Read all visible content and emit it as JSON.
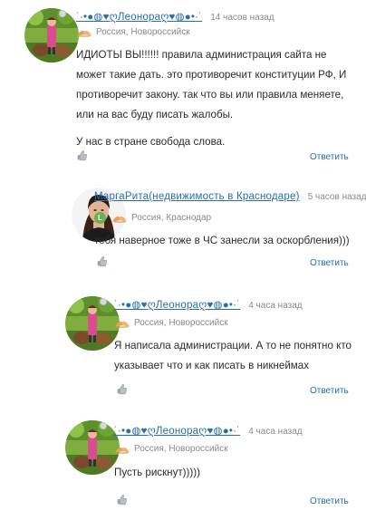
{
  "comments": [
    {
      "author": "˙·•●◍♥ღ​Леонораღ♥◍●•·˙",
      "time": "14 часов назад",
      "location": "Россия, Новороссийск",
      "paragraphs": [
        "ИДИОТЫ ВЫ!!!!!! правила администрация сайта не может такие дать. это противоречит конституции РФ, И противоречит закону. так что вы или правила меняете, или на вас буду писать жалобы.",
        "У нас в стране свобода слова."
      ],
      "reply_label": "Ответить"
    },
    {
      "author": "МаргаРита(недвижимость в Краснодаре)",
      "time": "5 часов назад",
      "location": "Россия, Краснодар",
      "badge": "L",
      "paragraphs": [
        "тебя наверное тоже в ЧС занесли за оскорбления)))"
      ],
      "reply_label": "Ответить"
    },
    {
      "author": "˙·•●◍♥ღ​Леонораღ♥◍●•·˙",
      "time": "4 часа назад",
      "location": "Россия, Новороссийск",
      "paragraphs": [
        "Я написала администрации. А то не понятно кто указывает что и как писать в никнеймах"
      ],
      "reply_label": "Ответить"
    },
    {
      "author": "˙·•●◍♥ღ​Леонораღ♥◍●•·˙",
      "time": "4 часа назад",
      "location": "Россия, Новороссийск",
      "paragraphs": [
        "Пусть рискнут)))))"
      ],
      "reply_label": "Ответить"
    }
  ],
  "colors": {
    "link": "#2a6ea8",
    "muted": "#8a8a8a",
    "badge": "#6ab04c"
  }
}
